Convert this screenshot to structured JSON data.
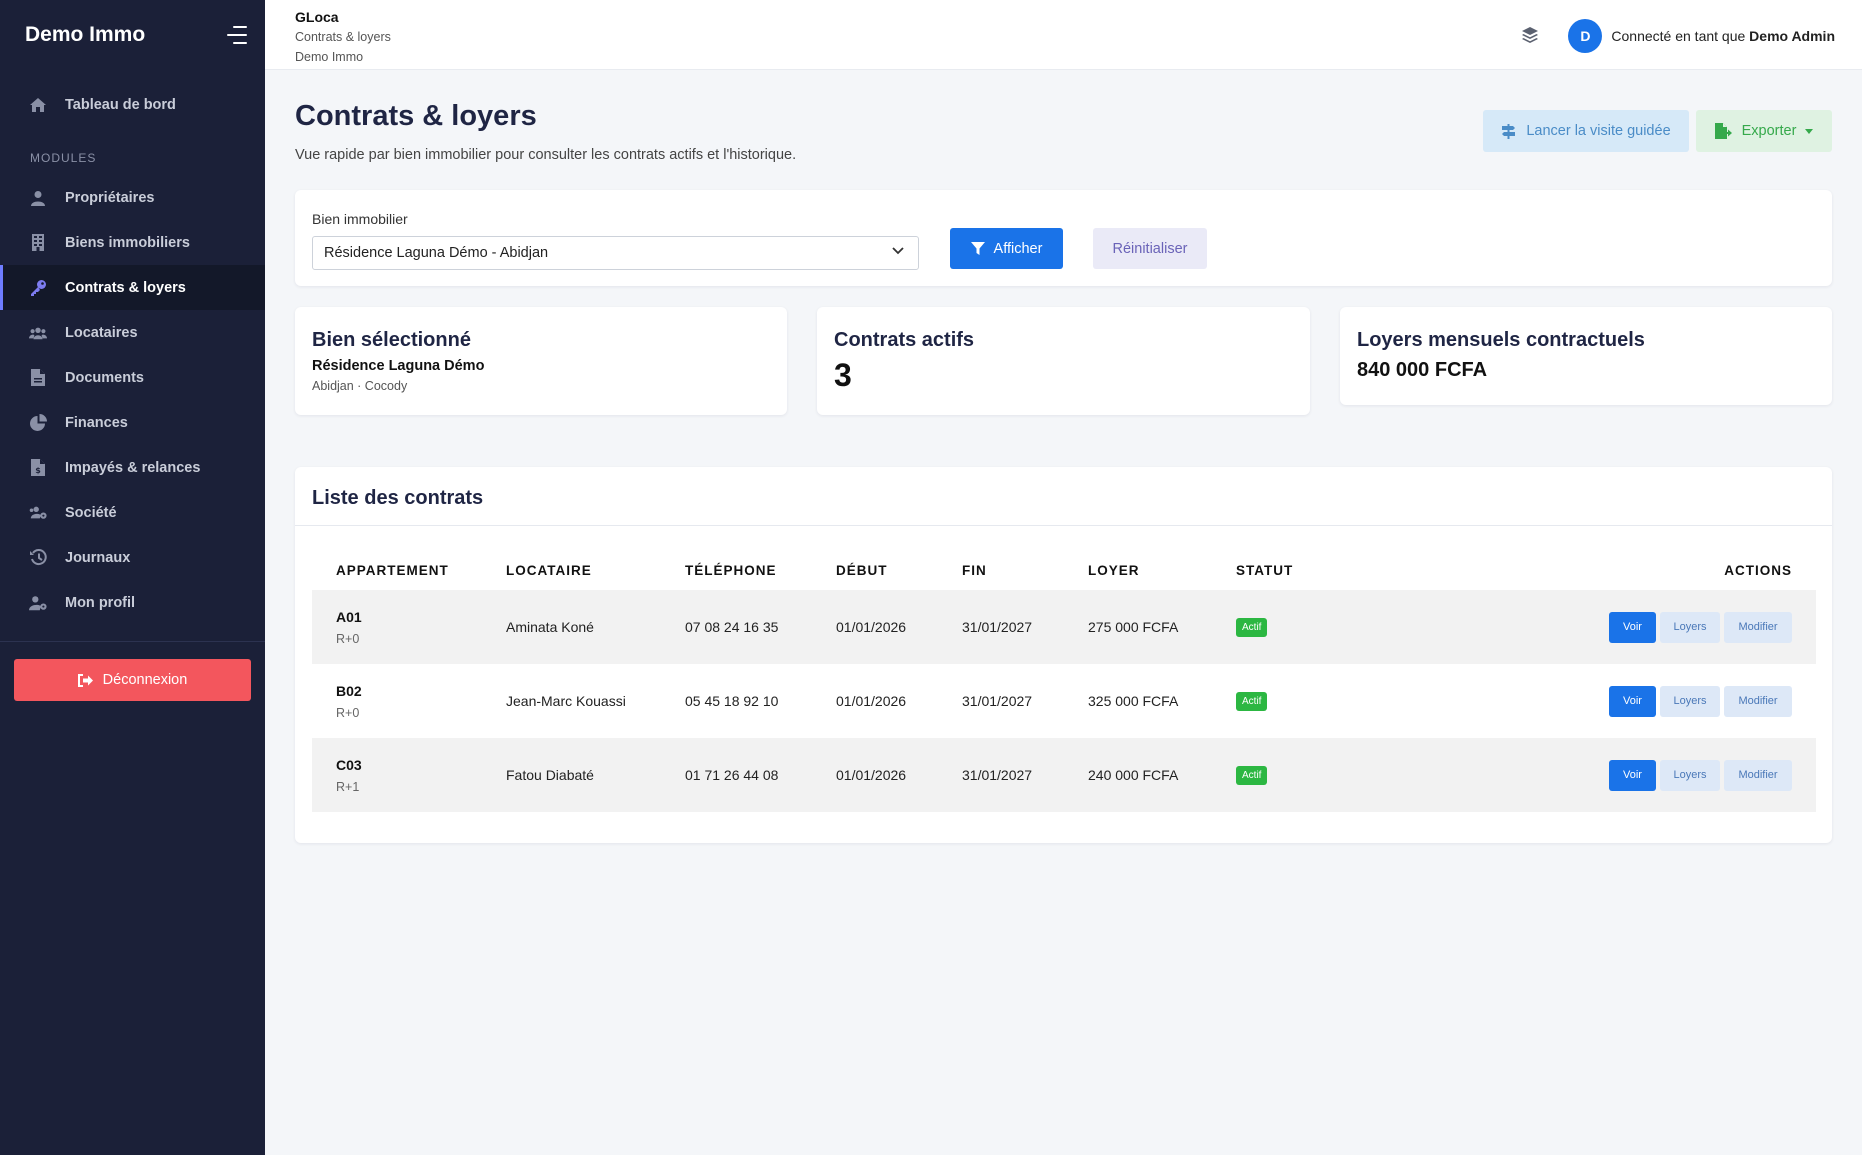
{
  "sidebar": {
    "brand": "Demo Immo",
    "dashboard": "Tableau de bord",
    "section_label": "MODULES",
    "items": [
      {
        "label": "Propriétaires",
        "icon": "user-tie-icon"
      },
      {
        "label": "Biens immobiliers",
        "icon": "building-icon"
      },
      {
        "label": "Contrats & loyers",
        "icon": "key-icon",
        "active": true
      },
      {
        "label": "Locataires",
        "icon": "users-icon"
      },
      {
        "label": "Documents",
        "icon": "file-icon"
      },
      {
        "label": "Finances",
        "icon": "chart-pie-icon"
      },
      {
        "label": "Impayés & relances",
        "icon": "file-invoice-icon"
      },
      {
        "label": "Société",
        "icon": "users-cog-icon"
      },
      {
        "label": "Journaux",
        "icon": "history-icon"
      },
      {
        "label": "Mon profil",
        "icon": "user-cog-icon"
      }
    ],
    "logout": "Déconnexion"
  },
  "topbar": {
    "app": "GLoca",
    "page": "Contrats & loyers",
    "company": "Demo Immo",
    "avatar_letter": "D",
    "connected_prefix": "Connecté en tant que",
    "user": "Demo Admin"
  },
  "header": {
    "title": "Contrats & loyers",
    "description": "Vue rapide par bien immobilier pour consulter les contrats actifs et l'historique.",
    "tour_button": "Lancer la visite guidée",
    "export_button": "Exporter"
  },
  "filter": {
    "label": "Bien immobilier",
    "selected": "Résidence Laguna Démo - Abidjan",
    "apply": "Afficher",
    "reset": "Réinitialiser"
  },
  "stats": {
    "selected_title": "Bien sélectionné",
    "selected_name": "Résidence Laguna Démo",
    "selected_location": "Abidjan · Cocody",
    "active_title": "Contrats actifs",
    "active_count": "3",
    "rent_title": "Loyers mensuels contractuels",
    "rent_total": "840 000 FCFA"
  },
  "contracts": {
    "title": "Liste des contrats",
    "columns": [
      "APPARTEMENT",
      "LOCATAIRE",
      "TÉLÉPHONE",
      "DÉBUT",
      "FIN",
      "LOYER",
      "STATUT",
      "ACTIONS"
    ],
    "rows": [
      {
        "unit": "A01",
        "floor": "R+0",
        "tenant": "Aminata Koné",
        "phone": "07 08 24 16 35",
        "start": "01/01/2026",
        "end": "31/01/2027",
        "rent": "275 000 FCFA",
        "status": "Actif"
      },
      {
        "unit": "B02",
        "floor": "R+0",
        "tenant": "Jean-Marc Kouassi",
        "phone": "05 45 18 92 10",
        "start": "01/01/2026",
        "end": "31/01/2027",
        "rent": "325 000 FCFA",
        "status": "Actif"
      },
      {
        "unit": "C03",
        "floor": "R+1",
        "tenant": "Fatou Diabaté",
        "phone": "01 71 26 44 08",
        "start": "01/01/2026",
        "end": "31/01/2027",
        "rent": "240 000 FCFA",
        "status": "Actif"
      }
    ],
    "actions": {
      "view": "Voir",
      "rents": "Loyers",
      "edit": "Modifier"
    }
  },
  "colors": {
    "sidebar_bg": "#1b2038",
    "primary": "#1a73e8",
    "danger": "#f3565d",
    "success": "#2cb742",
    "title": "#1f2544"
  }
}
